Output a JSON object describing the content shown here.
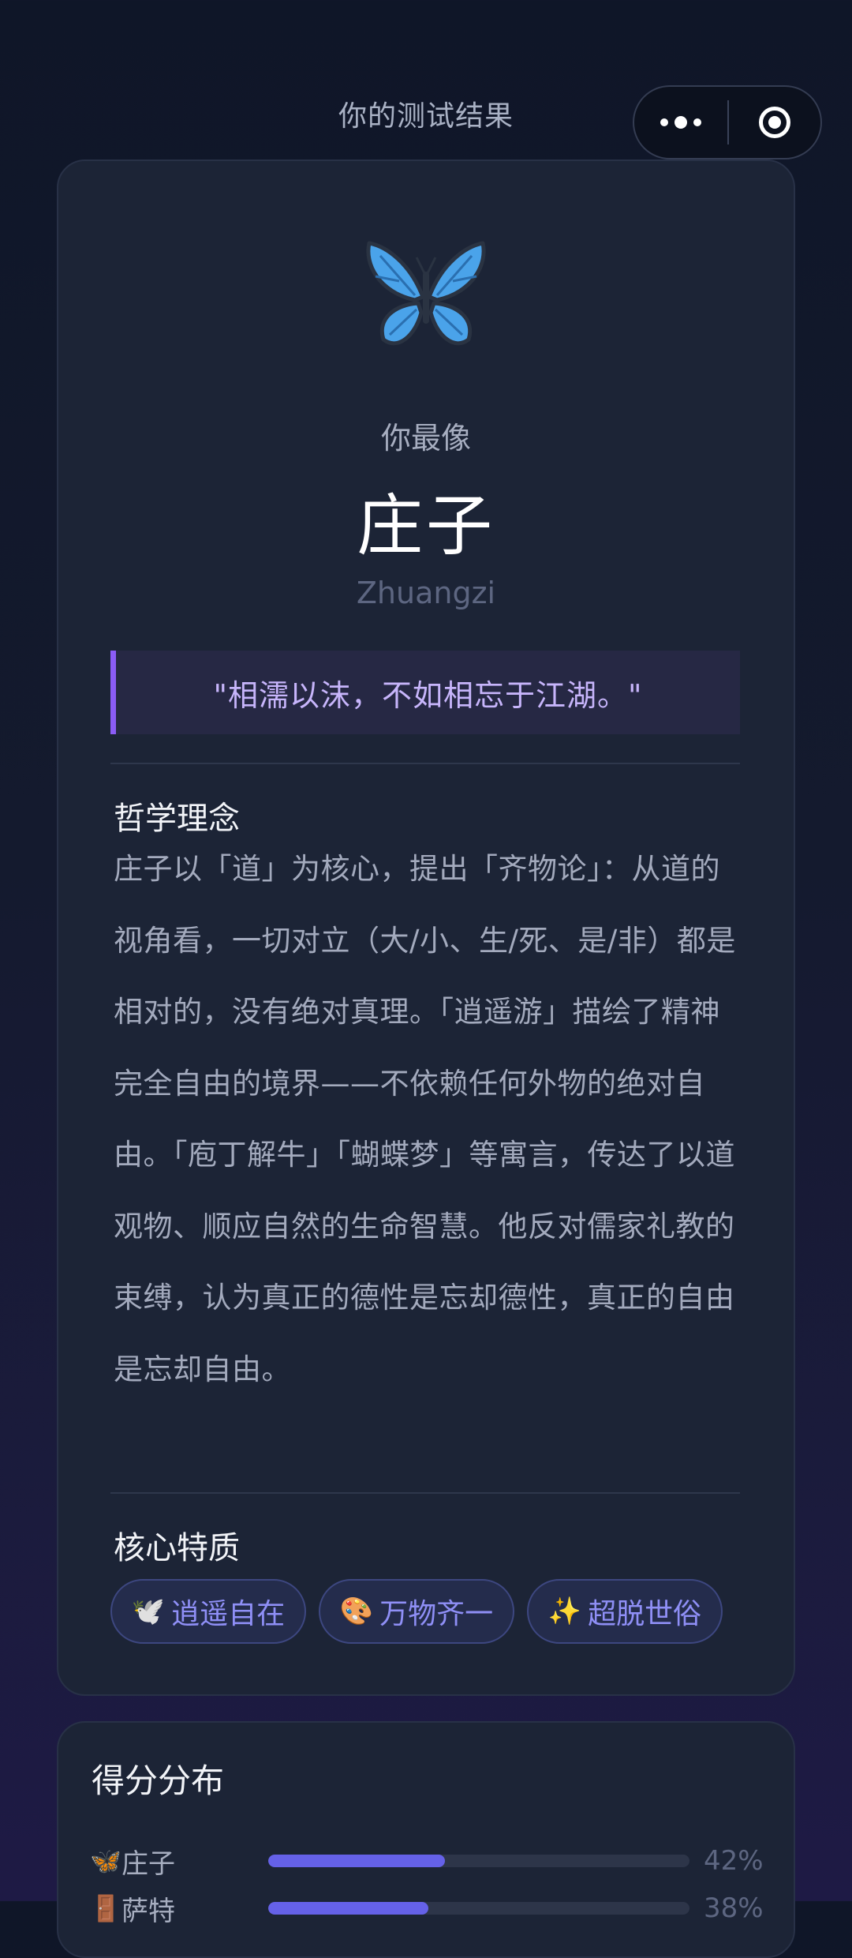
{
  "header": {
    "title": "你的测试结果"
  },
  "result": {
    "icon": "butterfly-icon",
    "subtitle": "你最像",
    "name": "庄子",
    "pinyin": "Zhuangzi",
    "quote": "\"相濡以沫，不如相忘于江湖。\"",
    "philosophy": {
      "title": "哲学理念",
      "text": "庄子以「道」为核心，提出「齐物论」：从道的视角看，一切对立（大/小、生/死、是/非）都是相对的，没有绝对真理。「逍遥游」描绘了精神完全自由的境界——不依赖任何外物的绝对自由。「庖丁解牛」「蝴蝶梦」等寓言，传达了以道观物、顺应自然的生命智慧。他反对儒家礼教的束缚，认为真正的德性是忘却德性，真正的自由是忘却自由。"
    },
    "traits": {
      "title": "核心特质",
      "items": [
        {
          "icon": "🕊️",
          "label": "逍遥自在"
        },
        {
          "icon": "🎨",
          "label": "万物齐一"
        },
        {
          "icon": "✨",
          "label": "超脱世俗"
        }
      ]
    }
  },
  "scores": {
    "title": "得分分布",
    "items": [
      {
        "icon": "🦋",
        "name": "庄子",
        "value": 0.42,
        "pct": "42%"
      },
      {
        "icon": "🚪",
        "name": "萨特",
        "value": 0.38,
        "pct": "38%"
      }
    ]
  },
  "colors": {
    "accent": "#8b5cf6",
    "bar": "#6561e8",
    "butterfly": "#4aa3ea"
  }
}
